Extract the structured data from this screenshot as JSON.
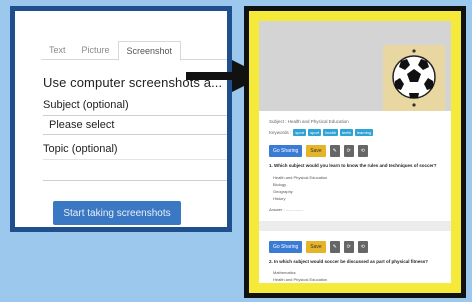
{
  "form": {
    "tabs": [
      "Text",
      "Picture",
      "Screenshot"
    ],
    "heading": "Use computer screenshots a... ...",
    "subject_label": "Subject (optional)",
    "subject_value": "Please select",
    "topic_label": "Topic (optional)",
    "topic_value": "",
    "start_button": "Start taking screenshots"
  },
  "preview": {
    "subject_line": "Subject : Health and Physical Education",
    "keywords_label": "Keywords :",
    "keywords": [
      "sport",
      "sport",
      "health",
      "teeth",
      "learning"
    ],
    "buttons": {
      "edit": "Go Sharing",
      "save": "Save",
      "icon1": "✎",
      "icon2": "⟳",
      "icon3": "⟲"
    },
    "question1": "1. Which subject would you learn to know the rules and techniques of soccer?",
    "q1_options": [
      "Health and Physical Education",
      "Biology",
      "Geography",
      "History"
    ],
    "q1_answer": "Answer : ................",
    "question2": "2. In which subject would soccer be discussed as part of physical fitness?",
    "q2_options": [
      "Mathematics",
      "Health and Physical Education"
    ]
  },
  "colors": {
    "background": "#9cc8ee",
    "left_frame": "#1f4f8c",
    "right_frame": "#111111",
    "highlight": "#f5e93a",
    "primary_button": "#3b78c4"
  }
}
